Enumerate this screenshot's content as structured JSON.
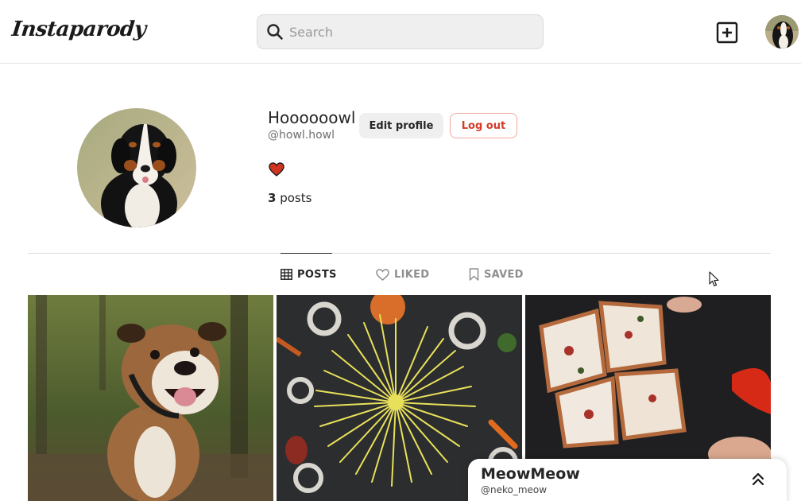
{
  "header": {
    "logo": "Instaparody",
    "search_placeholder": "Search",
    "new_post_icon": "plus-square-icon"
  },
  "profile": {
    "name": "Hoooooowl",
    "handle": "@howl.howl",
    "edit_label": "Edit profile",
    "logout_label": "Log out",
    "heart_color": "#d0361f",
    "posts_number": "3",
    "posts_label": " posts"
  },
  "tabs": [
    {
      "label": "POSTS",
      "icon": "grid-icon",
      "active": true
    },
    {
      "label": "LIKED",
      "icon": "heart-outline-icon",
      "active": false
    },
    {
      "label": "SAVED",
      "icon": "bookmark-icon",
      "active": false
    }
  ],
  "grid": [
    {
      "subject": "bulldog"
    },
    {
      "subject": "spaghetti"
    },
    {
      "subject": "pizza"
    }
  ],
  "panel": {
    "name": "MeowMeow",
    "handle": "@neko_meow",
    "toggle_icon": "chevrons-up-icon"
  },
  "colors": {
    "accent_red": "#d33d28",
    "border": "#dbdbdb",
    "muted": "#8e8e8e"
  }
}
